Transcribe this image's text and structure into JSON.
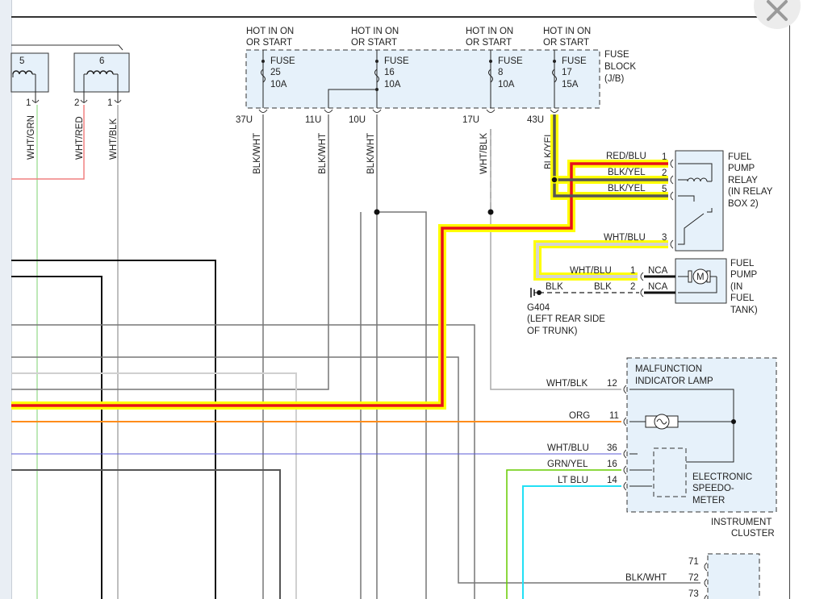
{
  "diagram": {
    "hot_labels": {
      "fuse25": [
        "HOT IN ON",
        "OR START"
      ],
      "fuse16": [
        "HOT IN ON",
        "OR START"
      ],
      "fuse8": [
        "HOT IN ON",
        "OR START"
      ],
      "fuse17": [
        "HOT IN ON",
        "OR START"
      ]
    },
    "fuses": [
      {
        "word": "FUSE",
        "num": "25",
        "amp": "10A"
      },
      {
        "word": "FUSE",
        "num": "16",
        "amp": "10A"
      },
      {
        "word": "FUSE",
        "num": "8",
        "amp": "10A"
      },
      {
        "word": "FUSE",
        "num": "17",
        "amp": "15A"
      }
    ],
    "fuse_block_label": [
      "FUSE",
      "BLOCK",
      "(J/B)"
    ],
    "fuse_terminals": [
      "37U",
      "11U",
      "10U",
      "17U",
      "43U"
    ],
    "fuse_wires": [
      "BLK/WHT",
      "BLK/WHT",
      "BLK/WHT",
      "WHT/BLK",
      "BLK/YEL"
    ],
    "left_components": [
      {
        "num": "5",
        "pin": "1",
        "wire": "WHT/GRN"
      },
      {
        "num": "6",
        "pin_a": "2",
        "wire_a": "WHT/RED",
        "pin_b": "1",
        "wire_b": "WHT/BLK"
      }
    ],
    "relay": {
      "label": [
        "FUEL",
        "PUMP",
        "RELAY",
        "(IN RELAY",
        "BOX 2)"
      ],
      "pins": [
        {
          "wire": "RED/BLU",
          "pin": "1"
        },
        {
          "wire": "BLK/YEL",
          "pin": "2"
        },
        {
          "wire": "BLK/YEL",
          "pin": "5"
        },
        {
          "wire": "WHT/BLU",
          "pin": "3"
        }
      ]
    },
    "pump": {
      "label": [
        "FUEL",
        "PUMP",
        "(IN",
        "FUEL",
        "TANK)"
      ],
      "motor": "M",
      "pins": [
        {
          "wire": "WHT/BLU",
          "pin": "1",
          "conn": "NCA"
        },
        {
          "wire": "BLK",
          "pin": "2",
          "conn": "NCA"
        }
      ]
    },
    "ground": {
      "wire": "BLK",
      "label": [
        "G404",
        "(LEFT REAR SIDE",
        "OF TRUNK)"
      ]
    },
    "cluster": {
      "mil_label": [
        "MALFUNCTION",
        "INDICATOR LAMP"
      ],
      "speedo_label": [
        "ELECTRONIC",
        "SPEEDO-",
        "METER"
      ],
      "label": [
        "INSTRUMENT",
        "CLUSTER"
      ],
      "pins": [
        {
          "wire": "WHT/BLK",
          "pin": "12"
        },
        {
          "wire": "ORG",
          "pin": "11"
        },
        {
          "wire": "WHT/BLU",
          "pin": "36"
        },
        {
          "wire": "GRN/YEL",
          "pin": "16"
        },
        {
          "wire": "LT BLU",
          "pin": "14"
        }
      ]
    },
    "bottom_connector": {
      "pins": [
        "71",
        "72",
        "73"
      ],
      "wire": "BLK/WHT"
    },
    "colors": {
      "highlight": "#ffff00",
      "red_blu": "#e8101a",
      "blk_yel": "#555555",
      "wht_blu": "#d4d4d4",
      "org": "#ff8c1a",
      "blue": "#5b5bd6",
      "green": "#66cc00",
      "lt_blu": "#22e0f5",
      "component_fill": "#e6f1fa"
    }
  }
}
